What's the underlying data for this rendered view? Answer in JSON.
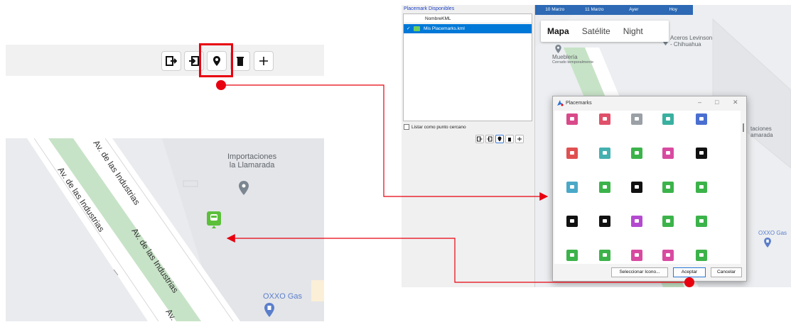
{
  "zoomed_toolbar": {
    "buttons": [
      {
        "icon": "export-icon"
      },
      {
        "icon": "import-icon"
      },
      {
        "icon": "map-pin-icon",
        "highlighted": true
      },
      {
        "icon": "trash-icon"
      },
      {
        "icon": "plus-icon"
      }
    ]
  },
  "zoom_map": {
    "streets": [
      "Av. de las Industrias",
      "Av. de las Industrias",
      "Av. de las Industrias",
      "Av."
    ],
    "poi_importaciones": "Importaciones\nla Llamarada",
    "poi_oxxo": "OXXO Gas"
  },
  "right": {
    "panel_header": "Placemark Disponibles",
    "list_header": "NombreKML",
    "list_item": "Mis Placemarks.kml",
    "checkbox_label": "Listar como punto cercano",
    "date_tabs": [
      "10 Marzo",
      "11 Marzo",
      "Ayer",
      "Hoy"
    ],
    "map_types": [
      "Mapa",
      "Satélite",
      "Night"
    ],
    "poi_aceros": "Aceros Levinson\n- Chihuahua",
    "poi_muebleria": "Mueblería",
    "poi_muebleria_sub": "Cerrado temporalmente",
    "poi_edge": "taciones\namarada",
    "poi_oxxo": "OXXO Gas",
    "dialog": {
      "title": "Placemarks",
      "buttons": {
        "select_icon": "Seleccionar Icono...",
        "accept": "Aceptar",
        "cancel": "Cancelar"
      }
    }
  },
  "colors": {
    "highlight_red": "#e8000f",
    "date_bar_blue": "#2d69b4",
    "selected_row_blue": "#0078d7",
    "placemark_green": "#5bbf3a"
  }
}
